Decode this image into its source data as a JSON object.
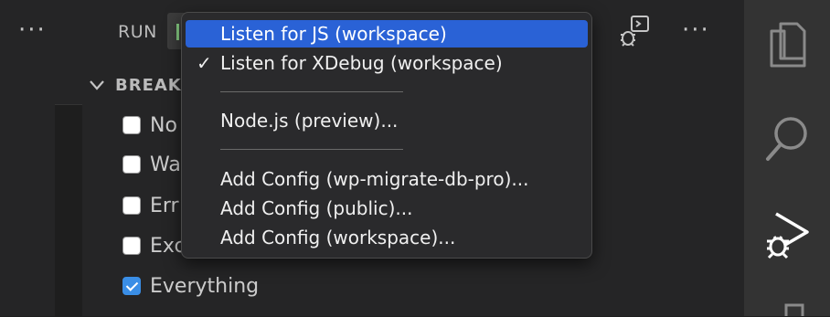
{
  "toolbar": {
    "more_left": "···",
    "run_label": "RUN",
    "more_right": "···",
    "debug_console_icon": "debug-console-icon"
  },
  "breakpoints": {
    "title": "BREAK",
    "items": [
      {
        "label": "No",
        "checked": false
      },
      {
        "label": "Wa",
        "checked": false
      },
      {
        "label": "Err",
        "checked": false
      },
      {
        "label": "Exc",
        "checked": false
      },
      {
        "label": "Everything",
        "checked": true
      }
    ]
  },
  "menu": {
    "items": [
      {
        "label": "Listen for JS (workspace)",
        "highlighted": true,
        "checked": false
      },
      {
        "label": "Listen for XDebug (workspace)",
        "highlighted": false,
        "checked": true
      },
      {
        "label": "Node.js (preview)...",
        "highlighted": false,
        "checked": false
      },
      {
        "label": "Add Config (wp-migrate-db-pro)...",
        "highlighted": false,
        "checked": false
      },
      {
        "label": "Add Config (public)...",
        "highlighted": false,
        "checked": false
      },
      {
        "label": "Add Config (workspace)...",
        "highlighted": false,
        "checked": false
      }
    ],
    "check_glyph": "✓"
  },
  "activity_bar": {
    "icons": [
      "explorer-icon",
      "search-icon",
      "run-debug-icon",
      "extensions-icon"
    ]
  },
  "colors": {
    "highlight": "#2a62d6",
    "checkbox_checked": "#3a8ee6",
    "run_play": "#89d185"
  }
}
